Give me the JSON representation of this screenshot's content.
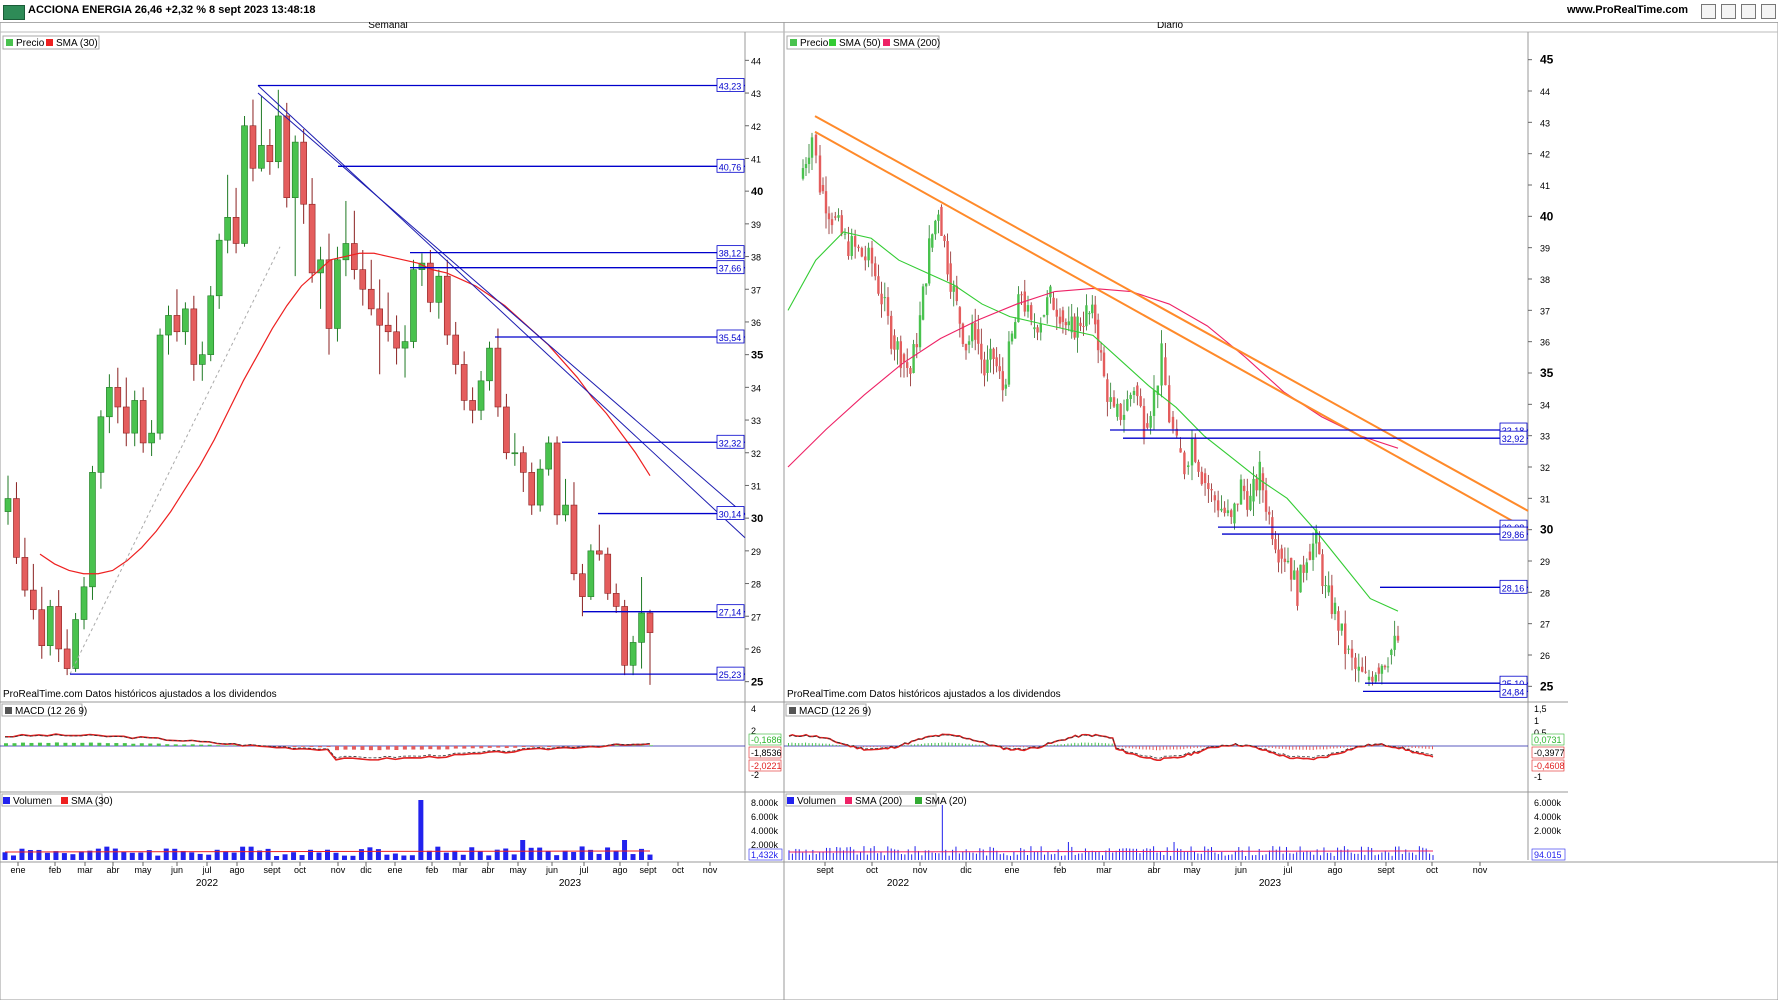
{
  "header": {
    "title": "ACCIONA ENERGIA 26,46 +2,32 % 8 sept 2023 13:48:18",
    "site": "www.ProRealTime.com"
  },
  "colors": {
    "up": "#49c24e",
    "down": "#e45d5d",
    "price_line": "#0000cc",
    "sma": "#ee2020",
    "sma50": "#33cc33",
    "sma200": "#ee2266",
    "trend_blue": "#1c1cb0",
    "trend_orange": "#ff8a2a",
    "volume": "#2222ee"
  },
  "left": {
    "panel_title": "Semanal",
    "legend": [
      "Precio",
      "SMA (30)"
    ],
    "footer": "ProRealTime.com Datos históricos ajustados a los dividendos",
    "macd_legend": "MACD (12 26 9)",
    "macd_labels": [
      "-0,1686",
      "-1,8536",
      "-2,0221"
    ],
    "macd_ticks": [
      "4",
      "2",
      "-2"
    ],
    "volume_legend": [
      "Volumen",
      "SMA (30)"
    ],
    "volume_ticks": [
      "8.000k",
      "6.000k",
      "4.000k",
      "2.000k"
    ],
    "volume_label": "1,432k",
    "months": [
      "ene",
      "feb",
      "mar",
      "abr",
      "may",
      "jun",
      "jul",
      "ago",
      "sept",
      "oct",
      "nov",
      "dic",
      "ene",
      "feb",
      "mar",
      "abr",
      "may",
      "jun",
      "jul",
      "ago",
      "sept",
      "oct",
      "nov"
    ],
    "years": [
      "2022",
      "2023"
    ]
  },
  "right": {
    "panel_title": "Diario",
    "legend": [
      "Precio",
      "SMA (50)",
      "SMA (200)"
    ],
    "footer": "ProRealTime.com Datos históricos ajustados a los dividendos",
    "macd_legend": "MACD (12 26 9)",
    "macd_labels": [
      "0,0731",
      "-0,3977",
      "-0,4608"
    ],
    "macd_ticks": [
      "1,5",
      "1",
      "0,5",
      "-1"
    ],
    "volume_legend": [
      "Volumen",
      "SMA (200)",
      "SMA (20)"
    ],
    "volume_ticks": [
      "6.000k",
      "4.000k",
      "2.000k"
    ],
    "volume_label": "94.015",
    "months": [
      "sept",
      "oct",
      "nov",
      "dic",
      "ene",
      "feb",
      "mar",
      "abr",
      "may",
      "jun",
      "jul",
      "ago",
      "sept",
      "oct",
      "nov"
    ],
    "years": [
      "2022",
      "2023"
    ]
  },
  "chart_data": [
    {
      "type": "candlestick",
      "title": "Semanal",
      "ylim": [
        24.5,
        44.5
      ],
      "y_ticks_bold": [
        "25",
        "30",
        "35",
        "40"
      ],
      "y_ticks": [
        "26",
        "27",
        "28",
        "29",
        "31",
        "32",
        "33",
        "34",
        "36",
        "37",
        "38",
        "39",
        "41",
        "42",
        "43",
        "44"
      ],
      "price_levels": [
        "43,23",
        "40,76",
        "38,12",
        "37,66",
        "35,54",
        "32,32",
        "30,14",
        "27,14",
        "25,23"
      ],
      "series": [
        {
          "name": "Precio",
          "ohlc": [
            [
              30.2,
              31.3,
              29.8,
              30.6
            ],
            [
              30.6,
              31.1,
              28.6,
              28.8
            ],
            [
              28.8,
              29.4,
              27.6,
              27.8
            ],
            [
              27.8,
              28.6,
              26.9,
              27.2
            ],
            [
              27.2,
              27.9,
              25.7,
              26.1
            ],
            [
              26.1,
              27.5,
              25.8,
              27.3
            ],
            [
              27.3,
              27.8,
              25.6,
              26.0
            ],
            [
              26.0,
              26.6,
              25.2,
              25.4
            ],
            [
              25.4,
              27.1,
              25.3,
              26.9
            ],
            [
              26.9,
              28.2,
              26.6,
              27.9
            ],
            [
              27.9,
              31.6,
              27.5,
              31.4
            ],
            [
              31.4,
              33.3,
              30.9,
              33.1
            ],
            [
              33.1,
              34.4,
              32.6,
              34.0
            ],
            [
              34.0,
              34.6,
              32.9,
              33.4
            ],
            [
              33.4,
              34.3,
              32.2,
              32.6
            ],
            [
              32.6,
              33.9,
              32.2,
              33.6
            ],
            [
              33.6,
              34.0,
              32.0,
              32.3
            ],
            [
              32.3,
              33.0,
              31.9,
              32.6
            ],
            [
              32.6,
              35.8,
              32.4,
              35.6
            ],
            [
              35.6,
              36.5,
              35.0,
              36.2
            ],
            [
              36.2,
              37.0,
              35.4,
              35.7
            ],
            [
              35.7,
              36.6,
              35.3,
              36.4
            ],
            [
              36.4,
              36.8,
              34.2,
              34.7
            ],
            [
              34.7,
              35.4,
              34.2,
              35.0
            ],
            [
              35.0,
              37.1,
              34.8,
              36.8
            ],
            [
              36.8,
              38.7,
              36.4,
              38.5
            ],
            [
              38.5,
              40.5,
              38.1,
              39.2
            ],
            [
              39.2,
              40.1,
              38.1,
              38.4
            ],
            [
              38.4,
              42.3,
              38.3,
              42.0
            ],
            [
              42.0,
              42.8,
              40.3,
              40.7
            ],
            [
              40.7,
              42.9,
              40.6,
              41.4
            ],
            [
              41.4,
              41.9,
              40.5,
              40.9
            ],
            [
              40.9,
              43.1,
              40.7,
              42.3
            ],
            [
              42.3,
              42.7,
              39.5,
              39.8
            ],
            [
              39.8,
              41.7,
              37.4,
              41.5
            ],
            [
              41.5,
              41.9,
              39.0,
              39.6
            ],
            [
              39.6,
              40.4,
              37.2,
              37.5
            ],
            [
              37.5,
              38.3,
              36.4,
              37.9
            ],
            [
              37.9,
              38.7,
              35.0,
              35.8
            ],
            [
              35.8,
              38.3,
              35.4,
              37.9
            ],
            [
              37.9,
              39.7,
              37.4,
              38.4
            ],
            [
              38.4,
              39.4,
              37.3,
              37.6
            ],
            [
              37.6,
              38.2,
              36.5,
              37.0
            ],
            [
              37.0,
              37.9,
              36.2,
              36.4
            ],
            [
              36.4,
              37.3,
              34.4,
              35.9
            ],
            [
              35.9,
              36.9,
              35.4,
              35.7
            ],
            [
              35.7,
              36.2,
              34.7,
              35.2
            ],
            [
              35.2,
              35.9,
              34.3,
              35.4
            ],
            [
              35.4,
              37.9,
              35.2,
              37.6
            ],
            [
              37.6,
              38.1,
              37.1,
              37.8
            ],
            [
              37.8,
              38.2,
              36.3,
              36.6
            ],
            [
              36.6,
              37.6,
              36.1,
              37.4
            ],
            [
              37.4,
              37.9,
              35.3,
              35.6
            ],
            [
              35.6,
              36.0,
              34.4,
              34.7
            ],
            [
              34.7,
              35.1,
              33.3,
              33.6
            ],
            [
              33.6,
              34.0,
              32.9,
              33.3
            ],
            [
              33.3,
              34.5,
              33.0,
              34.2
            ],
            [
              34.2,
              35.4,
              33.9,
              35.2
            ],
            [
              35.2,
              35.8,
              33.1,
              33.4
            ],
            [
              33.4,
              33.8,
              31.8,
              32.0
            ],
            [
              32.0,
              32.6,
              31.6,
              32.0
            ],
            [
              32.0,
              32.2,
              30.8,
              31.4
            ],
            [
              31.4,
              31.7,
              30.1,
              30.4
            ],
            [
              30.4,
              31.8,
              30.2,
              31.5
            ],
            [
              31.5,
              32.5,
              31.3,
              32.3
            ],
            [
              32.3,
              32.5,
              29.8,
              30.1
            ],
            [
              30.1,
              31.2,
              29.9,
              30.4
            ],
            [
              30.4,
              31.1,
              28.1,
              28.3
            ],
            [
              28.3,
              28.6,
              27.0,
              27.6
            ],
            [
              27.6,
              29.2,
              27.5,
              29.0
            ],
            [
              29.0,
              29.8,
              28.7,
              28.9
            ],
            [
              28.9,
              29.1,
              27.5,
              27.7
            ],
            [
              27.7,
              28.0,
              27.1,
              27.3
            ],
            [
              27.3,
              27.5,
              25.2,
              25.5
            ],
            [
              25.5,
              26.4,
              25.2,
              26.2
            ],
            [
              26.2,
              28.2,
              25.4,
              27.1
            ],
            [
              27.1,
              27.2,
              24.9,
              26.5
            ]
          ]
        },
        {
          "name": "SMA (30)",
          "values": [
            28.9,
            28.6,
            28.4,
            28.3,
            28.3,
            28.4,
            28.7,
            29.1,
            29.6,
            30.2,
            30.9,
            31.6,
            32.4,
            33.3,
            34.2,
            35.0,
            35.8,
            36.5,
            37.1,
            37.5,
            37.9,
            38.0,
            38.1,
            38.1,
            38.0,
            37.9,
            37.8,
            37.6,
            37.5,
            37.3,
            37.1,
            36.8,
            36.5,
            36.1,
            35.7,
            35.3,
            34.8,
            34.3,
            33.7,
            33.2,
            32.6,
            32.0,
            31.3
          ]
        }
      ]
    },
    {
      "type": "candlestick",
      "title": "Diario",
      "ylim": [
        24.5,
        45.5
      ],
      "y_ticks_bold": [
        "25",
        "30",
        "35",
        "40",
        "45"
      ],
      "y_ticks": [
        "26",
        "27",
        "28",
        "29",
        "31",
        "32",
        "33",
        "34",
        "36",
        "37",
        "38",
        "39",
        "41",
        "42",
        "43",
        "44"
      ],
      "price_levels": [
        "33,18",
        "32,92",
        "30,08",
        "29,86",
        "28,16",
        "25,10",
        "24,84"
      ],
      "series": [
        {
          "name": "Precio",
          "closes_by_month": {
            "sept": [
              26.0,
              26.46
            ],
            "oct": [
              38.5,
              37.4,
              36.2,
              35.6,
              35.0
            ],
            "nov": [
              36.7,
              39.0,
              40.3,
              38.5,
              37.1
            ],
            "dic": [
              35.9,
              36.4,
              35.0,
              35.5,
              34.5
            ],
            "ene": [
              36.1,
              37.6,
              36.4,
              36.8,
              37.4
            ],
            "feb": [
              37.0,
              36.3,
              36.6,
              36.9,
              36.7
            ],
            "mar": [
              34.8,
              33.6,
              33.8,
              34.6,
              33.4
            ],
            "abr": [
              34.3,
              35.5,
              33.6,
              32.6,
              32.0
            ],
            "may": [
              32.9,
              31.8,
              31.1,
              30.7,
              30.2
            ],
            "jun": [
              31.4,
              30.9,
              31.8,
              30.4,
              29.4
            ],
            "jul": [
              29.1,
              28.0,
              29.3,
              29.6,
              28.0
            ],
            "ago": [
              27.4,
              26.2,
              25.5,
              25.2,
              25.6
            ]
          }
        },
        {
          "name": "SMA (50)",
          "values": [
            37.0,
            38.6,
            39.5,
            39.3,
            38.6,
            38.2,
            37.8,
            37.2,
            36.8,
            36.6,
            36.4,
            36.2,
            35.4,
            34.6,
            33.9,
            33.0,
            32.3,
            31.6,
            31.0,
            30.0,
            28.9,
            27.8,
            27.4
          ]
        },
        {
          "name": "SMA (200)",
          "values": [
            32.0,
            33.2,
            34.3,
            35.3,
            36.1,
            36.7,
            37.2,
            37.6,
            37.7,
            37.6,
            37.2,
            36.5,
            35.5,
            34.4,
            33.6,
            33.0,
            32.6
          ]
        }
      ]
    }
  ]
}
